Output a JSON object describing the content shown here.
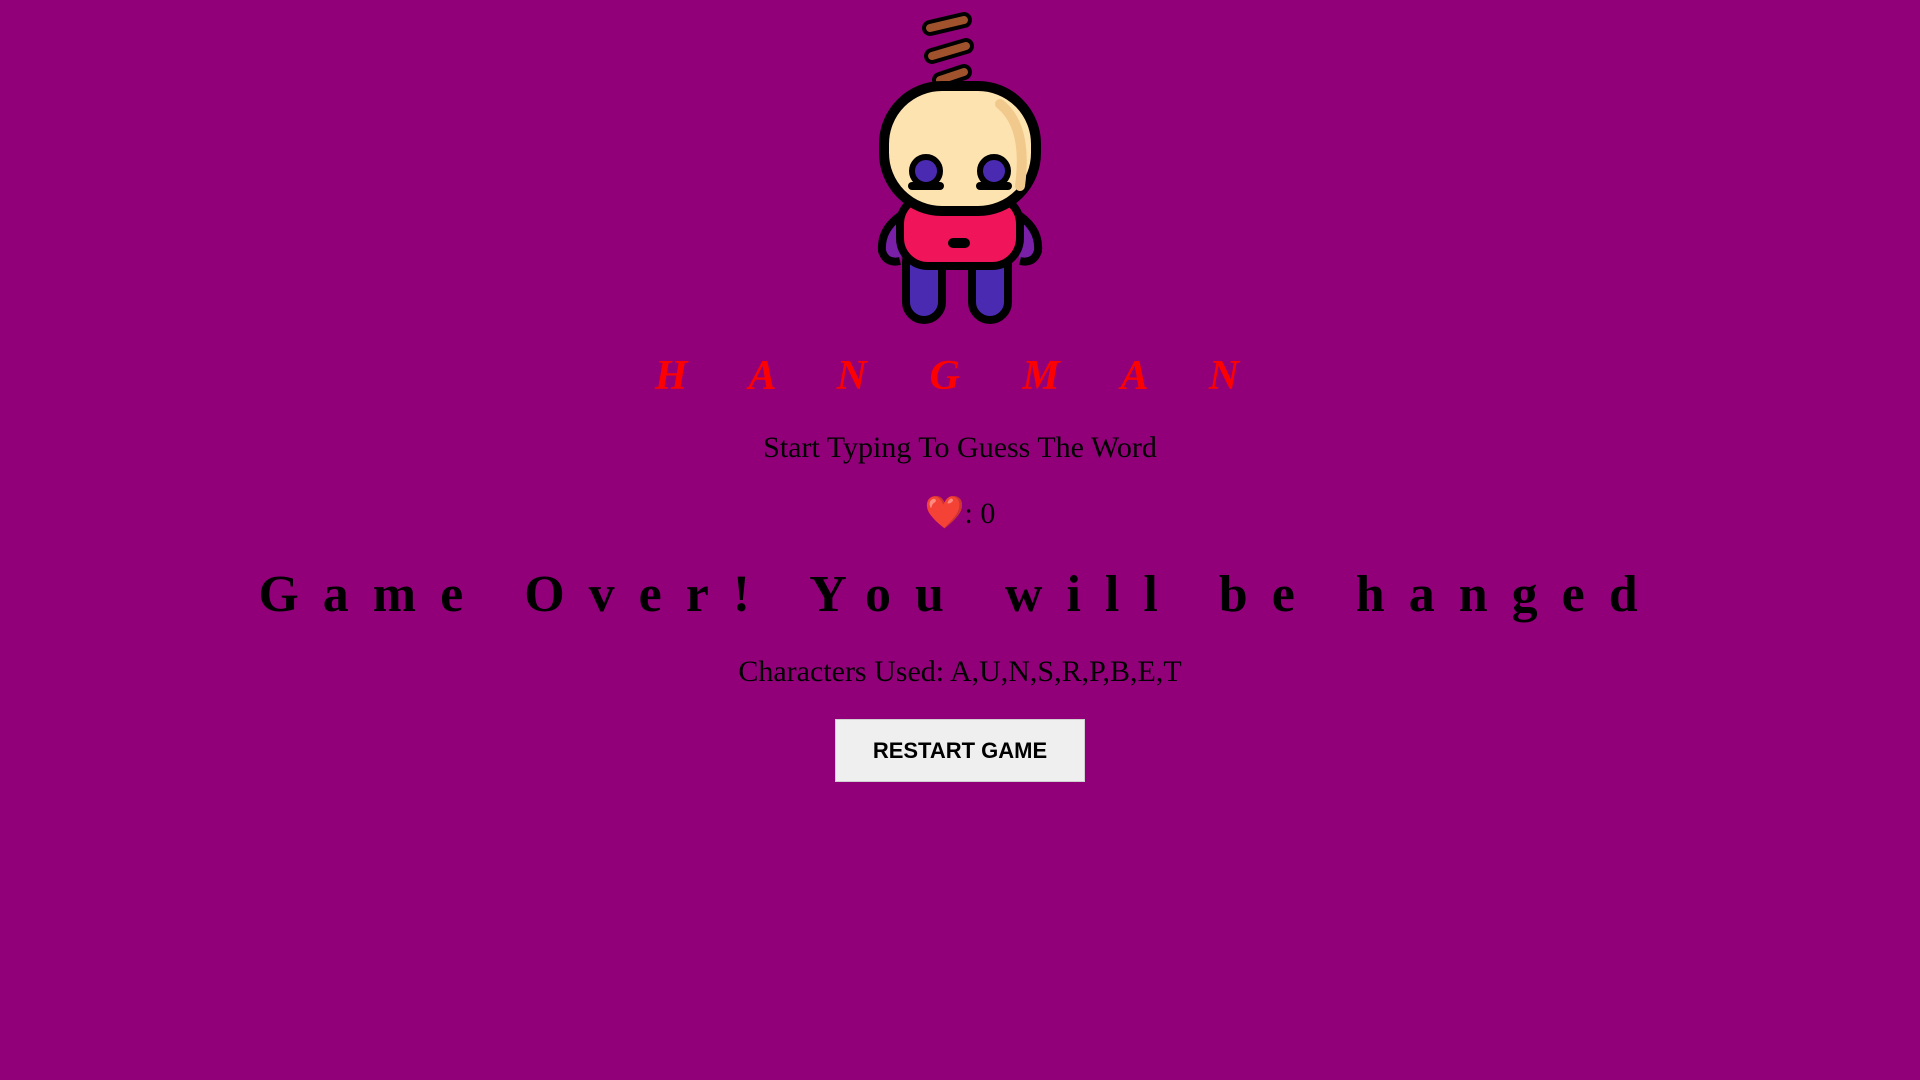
{
  "game": {
    "title": "H A N G M A N",
    "instruction": "Start Typing To Guess The Word",
    "lives": {
      "icon": "heart-icon",
      "symbol": "❤️",
      "separator": ": ",
      "value": "0"
    },
    "status_message": "Game Over! You will be hanged",
    "characters_used": "Characters Used: A,U,N,S,R,P,B,E,T",
    "restart_label": "RESTART GAME"
  },
  "colors": {
    "background": "#910079",
    "title": "#ff0000",
    "text": "#000000",
    "button_bg": "#efefef"
  }
}
